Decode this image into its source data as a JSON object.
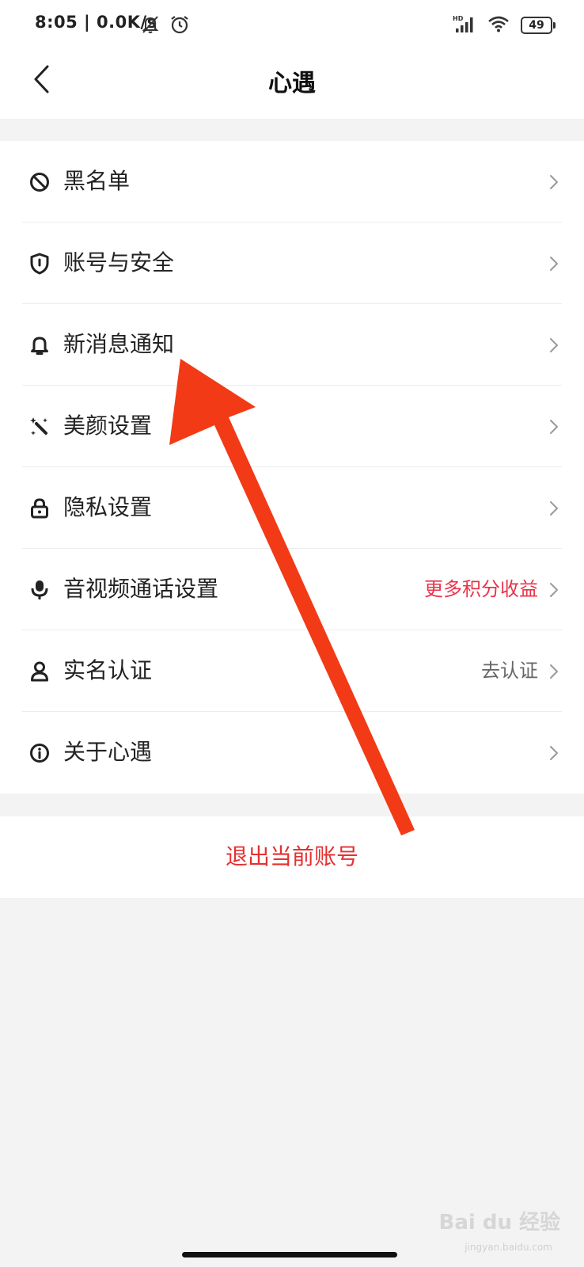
{
  "status_bar": {
    "time": "8:05 | 0.0K/s",
    "network_badge": "HD",
    "battery_level": "49"
  },
  "header": {
    "title": "心遇"
  },
  "menu": {
    "items": [
      {
        "label": "黑名单",
        "icon": "block-icon",
        "extra": ""
      },
      {
        "label": "账号与安全",
        "icon": "shield-icon",
        "extra": ""
      },
      {
        "label": "新消息通知",
        "icon": "bell-icon",
        "extra": ""
      },
      {
        "label": "美颜设置",
        "icon": "beauty-wand-icon",
        "extra": ""
      },
      {
        "label": "隐私设置",
        "icon": "lock-icon",
        "extra": ""
      },
      {
        "label": "音视频通话设置",
        "icon": "microphone-icon",
        "extra": "更多积分收益",
        "extra_color": "#e8344a"
      },
      {
        "label": "实名认证",
        "icon": "person-icon",
        "extra": "去认证",
        "extra_color": "#666666"
      },
      {
        "label": "关于心遇",
        "icon": "info-icon",
        "extra": ""
      }
    ]
  },
  "logout": {
    "label": "退出当前账号",
    "color": "#e53030"
  },
  "overlay": {
    "arrow_color": "#f23a16"
  },
  "watermark": {
    "text": "Bai du 经验",
    "sub": "jingyan.baidu.com"
  }
}
